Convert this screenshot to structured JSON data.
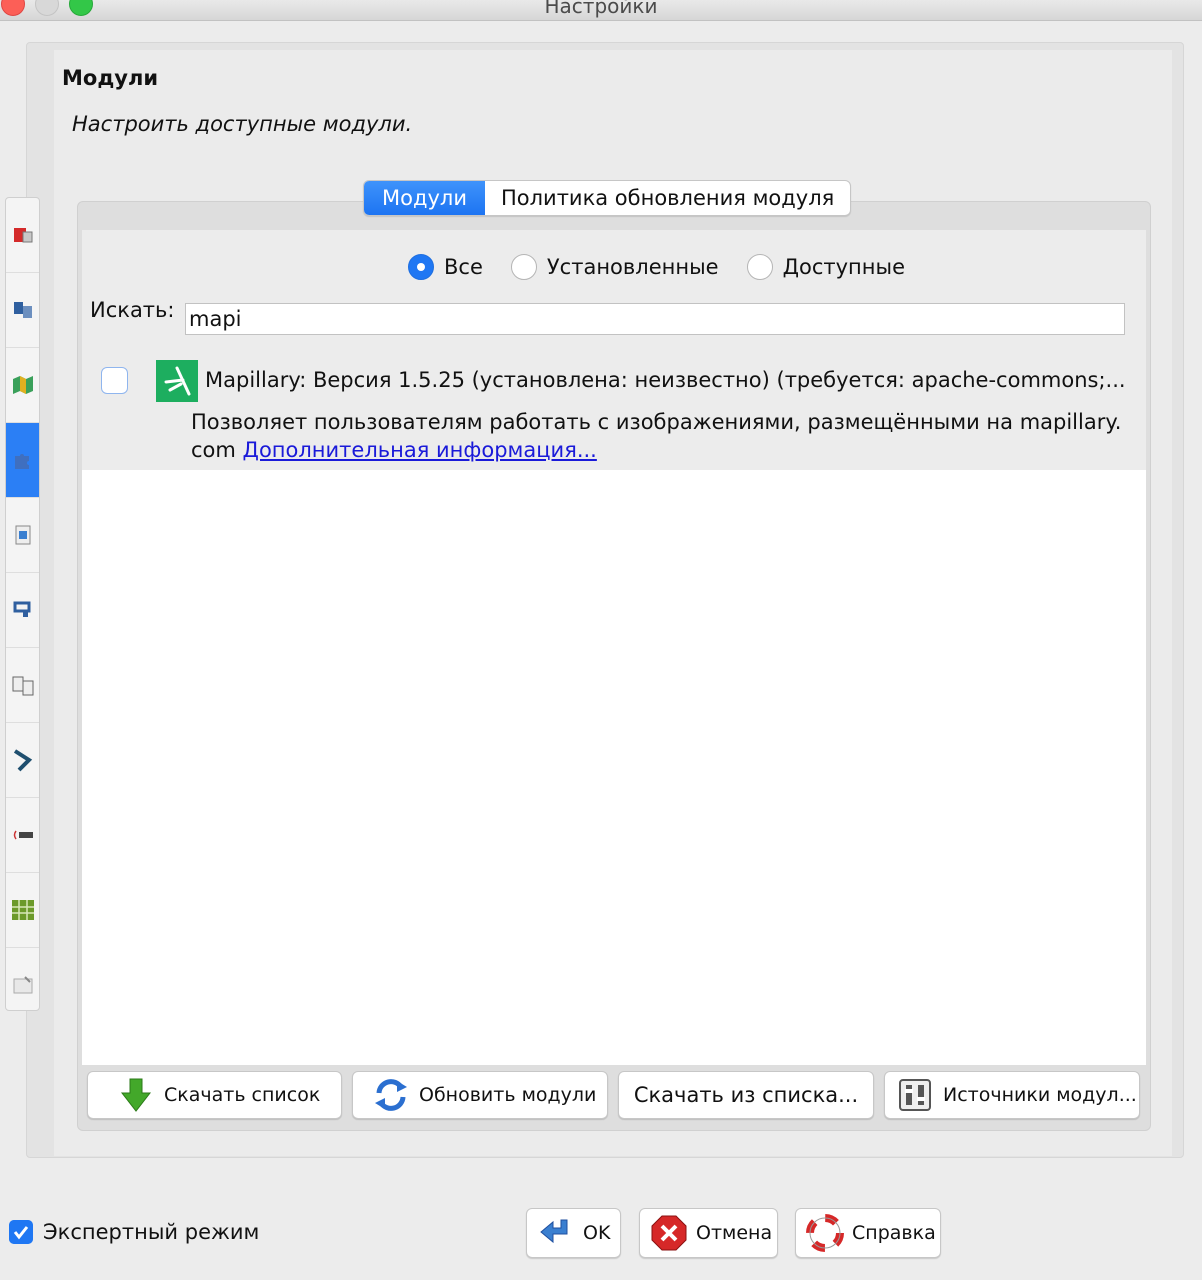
{
  "window": {
    "title": "Настройки"
  },
  "page": {
    "heading": "Модули",
    "subtitle": "Настроить доступные модули."
  },
  "sidebar": {
    "items": [
      {
        "icon": "display-settings-icon",
        "active": false
      },
      {
        "icon": "connection-settings-icon",
        "active": false
      },
      {
        "icon": "map-settings-icon",
        "active": false
      },
      {
        "icon": "plugin-puzzle-icon",
        "active": true
      },
      {
        "icon": "projection-icon",
        "active": false
      },
      {
        "icon": "remote-control-icon",
        "active": false
      },
      {
        "icon": "shortcuts-icon",
        "active": false
      },
      {
        "icon": "validator-icon",
        "active": false
      },
      {
        "icon": "audio-icon",
        "active": false
      },
      {
        "icon": "tagging-presets-icon",
        "active": false
      },
      {
        "icon": "advanced-preferences-icon",
        "active": false
      }
    ]
  },
  "tabs": [
    {
      "label": "Модули",
      "active": true
    },
    {
      "label": "Политика обновления модуля",
      "active": false
    }
  ],
  "filter": {
    "options": [
      {
        "label": "Все",
        "checked": true
      },
      {
        "label": "Установленные",
        "checked": false
      },
      {
        "label": "Доступные",
        "checked": false
      }
    ],
    "search_label": "Искать:",
    "search_value": "mapi"
  },
  "plugins": [
    {
      "checked": false,
      "title": "Mapillary: Версия 1.5.25 (установлена: неизвестно) (требуется: apache-commons;...",
      "description": "Позволяет пользователям работать с изображениями, размещёнными на mapillary. com",
      "link": "Дополнительная информация...",
      "logo_color": "#1dae5f"
    }
  ],
  "buttons": {
    "download_list": "Скачать список",
    "update_plugins": "Обновить модули",
    "download_from_list": "Скачать из списка...",
    "plugin_sources": "Источники модул..."
  },
  "footer": {
    "expert_mode": "Экспертный режим",
    "expert_checked": true,
    "ok": "OK",
    "cancel": "Отмена",
    "help": "Справка"
  },
  "colors": {
    "accent": "#1f77f3",
    "link": "#1a1ad9",
    "mapillary": "#1dae5f"
  }
}
